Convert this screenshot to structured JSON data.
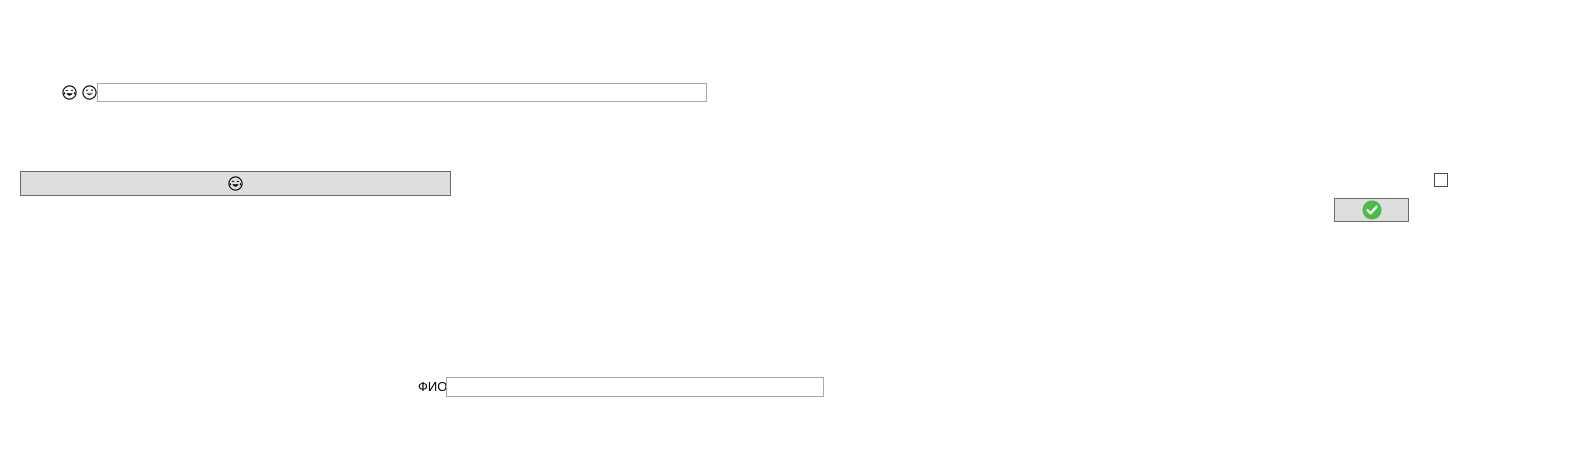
{
  "top_row": {
    "emoji_1": "tears-of-joy-icon",
    "emoji_2": "grinning-face-icon",
    "text_input": {
      "value": "",
      "placeholder": ""
    }
  },
  "emoji_button": {
    "label": "",
    "icon": "tears-of-joy-icon"
  },
  "confirm_area": {
    "checkbox_checked": false,
    "confirm_button_icon": "green-check-icon",
    "check_color": "#4cbb47"
  },
  "fio_row": {
    "label": "ФИО",
    "text_input": {
      "value": "",
      "placeholder": ""
    }
  }
}
